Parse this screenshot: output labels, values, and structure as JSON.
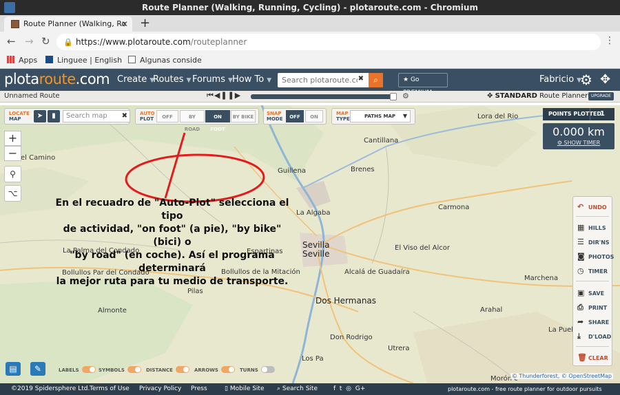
{
  "browser": {
    "window_title": "Route Planner (Walking, Running, Cycling) - plotaroute.com - Chromium",
    "tab_title": "Route Planner (Walking, Ro",
    "url_host": "https://www.plotaroute.com",
    "url_path": "/routeplanner",
    "bookmarks": [
      "Apps",
      "Linguee | English",
      "Algunas conside"
    ]
  },
  "site_nav": {
    "logo_left": "plota",
    "logo_middle": "route",
    "logo_right": ".com",
    "menus": [
      "Create",
      "Routes",
      "Forums",
      "How To"
    ],
    "search_placeholder": "Search plotaroute.com",
    "premium_label": "Go PREMIUM",
    "user_name": "Fabricio"
  },
  "route_bar": {
    "route_name": "Unnamed Route",
    "plan_bold": "STANDARD",
    "plan_rest": "Route Planner",
    "upgrade_label": "UPGRADE"
  },
  "map_controls": {
    "locate_label_1": "LOCATE",
    "locate_label_2": "MAP",
    "search_placeholder": "Search map",
    "autoplot_label_1": "AUTO",
    "autoplot_label_2": "PLOT",
    "autoplot_options": [
      "OFF",
      "BY ROAD",
      "ON FOOT",
      "BY BIKE"
    ],
    "autoplot_selected": "ON FOOT",
    "mode_label_1": "SNAP",
    "mode_label_2": "MODE",
    "mode_options": [
      "OFF",
      "ON"
    ],
    "maptype_label_1": "MAP",
    "maptype_label_2": "TYPE",
    "maptype_value": "PATHS MAP"
  },
  "stats": {
    "points_label": "POINTS PLOTTED",
    "points_value": "1",
    "distance": "0.000 km",
    "show_timer": "SHOW TIMER"
  },
  "actions": {
    "undo": "UNDO",
    "hills": "HILLS",
    "dirns": "DIR'NS",
    "photos": "PHOTOS",
    "timer": "TIMER",
    "save": "SAVE",
    "print": "PRINT",
    "share": "SHARE",
    "dload": "D'LOAD",
    "clear": "CLEAR"
  },
  "annotation": {
    "line1": "En el recuadro de \"Auto-Plot\" selecciona el tipo",
    "line2": "de actividad, \"on foot\" (a pie), \"by bike\" (bici) o",
    "line3": "\"by road\" (en coche). Así el programa determinará",
    "line4": "la mejor ruta para tu medio de transporte."
  },
  "map_places": {
    "lora": "Lora del Rio",
    "camino": "el Camino",
    "cantillana": "Cantillana",
    "brenes": "Brenes",
    "guillena": "Guillena",
    "algaba": "La Algaba",
    "carmona": "Carmona",
    "sevilla": "Sevilla",
    "seville": "Seville",
    "viso": "El Viso del Alcor",
    "palma": "La Palma del Condado",
    "espartinas": "Espartinas",
    "bollullos_par": "Bollullos Par del Condado",
    "bollullos_mit": "Bollullos de la Mitación",
    "alcala": "Alcalá de Guadaíra",
    "marchena": "Marchena",
    "pilas": "Pilas",
    "dos_hermanas": "Dos Hermanas",
    "almonte": "Almonte",
    "arahal": "Arahal",
    "don_rodrigo": "Don Rodrigo",
    "puebla": "La Pueb",
    "utrera": "Utrera",
    "los_pa": "Los Pa",
    "moron": "Morón c"
  },
  "map_toggles": {
    "labels": "LABELS",
    "symbols": "SYMBOLS",
    "distance": "DISTANCE",
    "arrows": "ARROWS",
    "turns": "TURNS"
  },
  "attribution": {
    "thunderforest": "© Thunderforest,",
    "osm": "© OpenStreetMap"
  },
  "footer": {
    "copyright": "©2019 Spidersphere Ltd.",
    "terms": "Terms of Use",
    "privacy": "Privacy Policy",
    "press": "Press",
    "mobile": "Mobile Site",
    "search": "Search Site",
    "tagline": "plotaroute.com - free route planner for outdoor pursuits"
  },
  "colors": {
    "nav": "#3a4f62",
    "accent": "#e8742b",
    "annotation_red": "#e31b1b",
    "map_bg": "#e9e8cf"
  }
}
